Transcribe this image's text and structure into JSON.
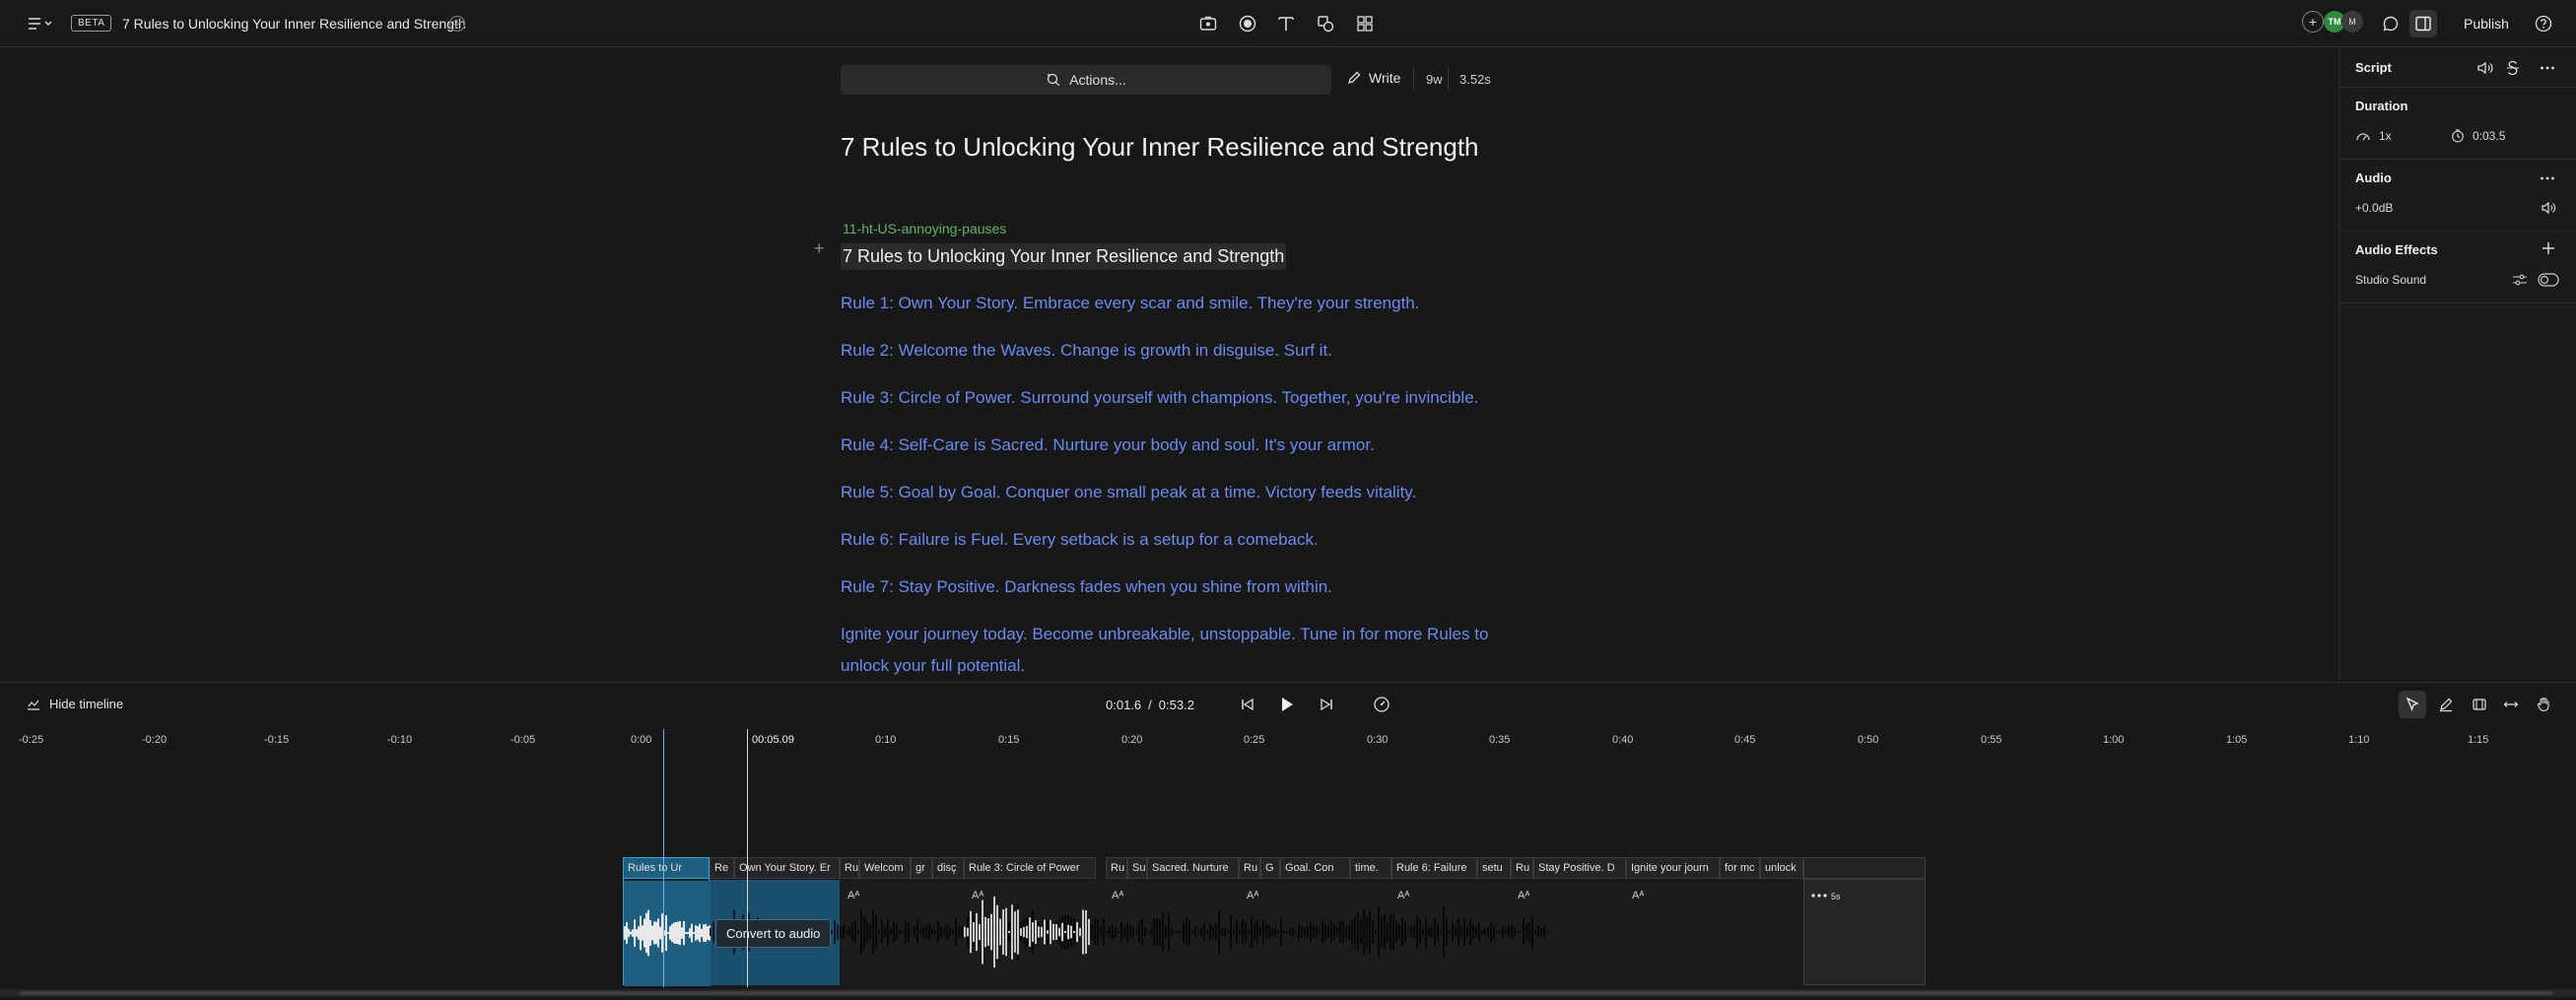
{
  "topbar": {
    "menu_icon": "hamburger-icon",
    "beta_badge": "BETA",
    "project_title": "7 Rules to Unlocking Your Inner Resilience and Strength",
    "tools": [
      "record-icon",
      "record-dot-icon",
      "text-icon",
      "shapes-icon",
      "grid-icon"
    ],
    "avatars": [
      "+",
      "TM",
      "M"
    ],
    "publish_label": "Publish"
  },
  "editor": {
    "actions_label": "Actions...",
    "write_label": "Write",
    "word_count": "9w",
    "duration": "3.52s",
    "doc_title": "7 Rules to Unlocking Your Inner Resilience and Strength",
    "speaker": "11-ht-US-annoying-pauses",
    "heading_line": "7 Rules to Unlocking Your Inner Resilience and Strength",
    "rules": [
      "Rule 1: Own Your Story. Embrace every scar and smile. They're your strength.",
      "Rule 2: Welcome the Waves. Change is growth in disguise. Surf it.",
      "Rule 3: Circle of Power. Surround yourself with champions. Together, you're invincible.",
      "Rule 4: Self-Care is Sacred. Nurture your body and soul. It's your armor.",
      "Rule 5: Goal by Goal. Conquer one small peak at a time. Victory feeds vitality.",
      "Rule 6: Failure is Fuel. Every setback is a setup for a comeback.",
      "Rule 7: Stay Positive. Darkness fades when you shine from within."
    ],
    "closing_line1": "Ignite your journey today. Become unbreakable, unstoppable. Tune in for more Rules to",
    "closing_line2": "unlock your full potential."
  },
  "panel": {
    "script_label": "Script",
    "duration_label": "Duration",
    "speed_value": "1x",
    "time_value": "0:03.5",
    "audio_label": "Audio",
    "gain_value": "+0.0dB",
    "effects_label": "Audio Effects",
    "studio_sound_label": "Studio Sound"
  },
  "timeline": {
    "hide_label": "Hide timeline",
    "current_time": "0:01.6",
    "separator": "/",
    "total_time": "0:53.2",
    "ruler_ticks": [
      "-0:25",
      "-0:20",
      "-0:15",
      "-0:10",
      "-0:05",
      "0:00",
      "0:10",
      "0:15",
      "0:20",
      "0:25",
      "0:30",
      "0:35",
      "0:40",
      "0:45",
      "0:50",
      "0:55",
      "1:00",
      "1:05",
      "1:10",
      "1:15"
    ],
    "playhead_label": "00:05.09",
    "clip_labels": [
      "Rules to Ur",
      "Re",
      "Own Your Story. Er",
      "Ru",
      "Welcom",
      "gr",
      "disç",
      "Rule 3: Circle of Power",
      "Ru",
      "Su",
      "Sacred. Nurture",
      "Ru",
      "G",
      "Goal. Con",
      "time.",
      "Rule 6: Failure",
      "setu",
      "Ru",
      "Stay Positive. D",
      "Ignite your journ",
      "for mc",
      "unlock"
    ],
    "aa_marker": "Aᴬ",
    "convert_label": "Convert to audio",
    "end_label": "5s"
  }
}
